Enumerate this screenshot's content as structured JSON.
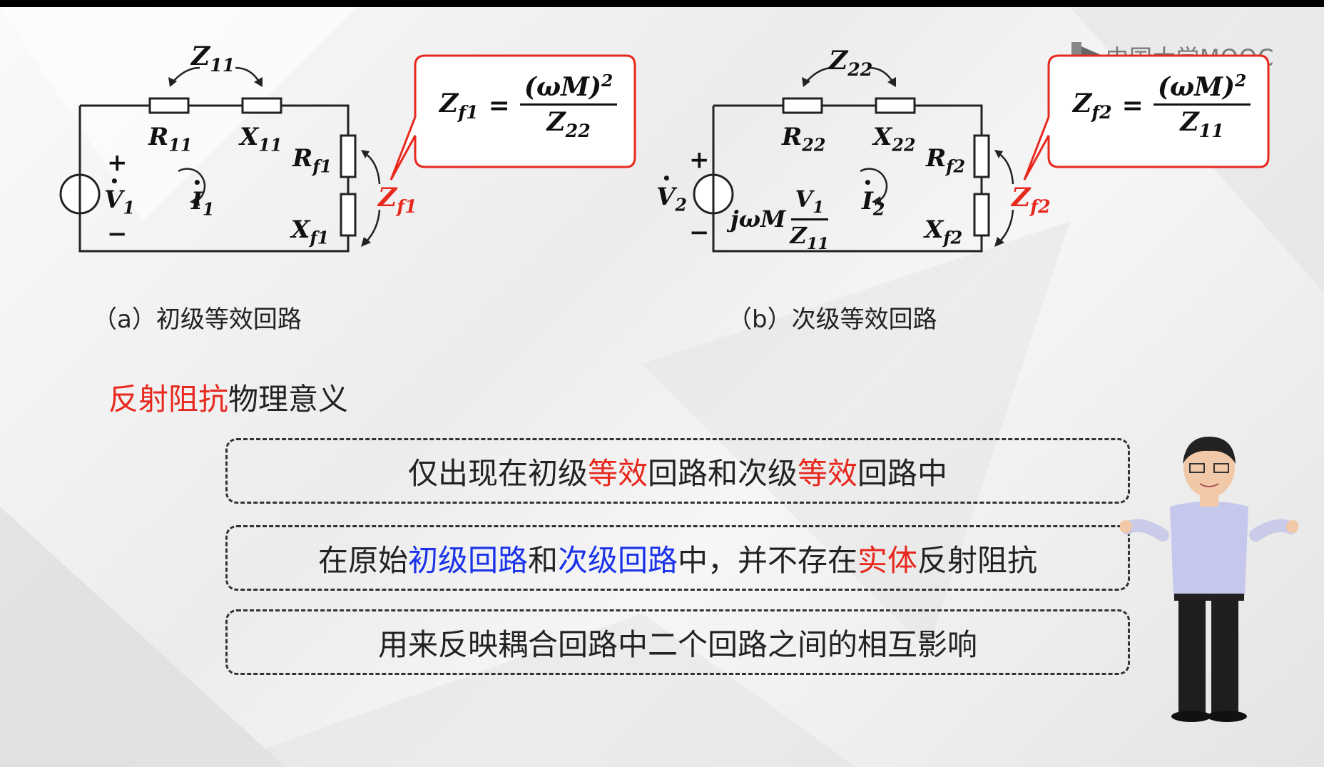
{
  "logo": {
    "text": "中国大学MOOC",
    "icon": "mooc-play-icon"
  },
  "circuit_a": {
    "caption": "（a）初级等效回路",
    "z_label": {
      "main": "Z",
      "sub": "11"
    },
    "r11": {
      "main": "R",
      "sub": "11"
    },
    "x11": {
      "main": "X",
      "sub": "11"
    },
    "rf1": {
      "main": "R",
      "sub": "f1"
    },
    "xf1": {
      "main": "X",
      "sub": "f1"
    },
    "zf1": {
      "main": "Z",
      "sub": "f1"
    },
    "source": {
      "main": "V",
      "sub": "1"
    },
    "current": {
      "main": "I",
      "sub": "1"
    },
    "plus": "+",
    "minus": "−",
    "formula": {
      "lhs_main": "Z",
      "lhs_sub": "f1",
      "eq": "=",
      "num": "(ωM)",
      "num_sup": "2",
      "den_main": "Z",
      "den_sub": "22"
    }
  },
  "circuit_b": {
    "caption": "（b）次级等效回路",
    "z_label": {
      "main": "Z",
      "sub": "22"
    },
    "r22": {
      "main": "R",
      "sub": "22"
    },
    "x22": {
      "main": "X",
      "sub": "22"
    },
    "rf2": {
      "main": "R",
      "sub": "f2"
    },
    "xf2": {
      "main": "X",
      "sub": "f2"
    },
    "zf2": {
      "main": "Z",
      "sub": "f2"
    },
    "source": {
      "main": "V",
      "sub": "2"
    },
    "current": {
      "main": "I",
      "sub": "2"
    },
    "plus": "+",
    "minus": "−",
    "jwm": "jωM",
    "src_frac": {
      "num_main": "V",
      "num_sub": "1",
      "den_main": "Z",
      "den_sub": "11"
    },
    "formula": {
      "lhs_main": "Z",
      "lhs_sub": "f2",
      "eq": "=",
      "num": "(ωM)",
      "num_sup": "2",
      "den_main": "Z",
      "den_sub": "11"
    }
  },
  "section": {
    "title_red": "反射阻抗",
    "title_rest": "物理意义"
  },
  "points": [
    {
      "segments": [
        {
          "t": "仅出现在初级",
          "c": "normal"
        },
        {
          "t": "等效",
          "c": "red"
        },
        {
          "t": "回路和次级",
          "c": "normal"
        },
        {
          "t": "等效",
          "c": "red"
        },
        {
          "t": "回路中",
          "c": "normal"
        }
      ]
    },
    {
      "segments": [
        {
          "t": "在原始",
          "c": "normal"
        },
        {
          "t": "初级回路",
          "c": "blue"
        },
        {
          "t": "和",
          "c": "normal"
        },
        {
          "t": "次级回路",
          "c": "blue"
        },
        {
          "t": "中，并不存在",
          "c": "normal"
        },
        {
          "t": "实体",
          "c": "red"
        },
        {
          "t": "反射阻抗",
          "c": "normal"
        }
      ]
    },
    {
      "segments": [
        {
          "t": "用来反映耦合回路中二个回路之间的相互影响",
          "c": "normal"
        }
      ]
    }
  ],
  "colors": {
    "accent_red": "#e8281e",
    "accent_blue": "#1a32e8",
    "text": "#222222"
  }
}
